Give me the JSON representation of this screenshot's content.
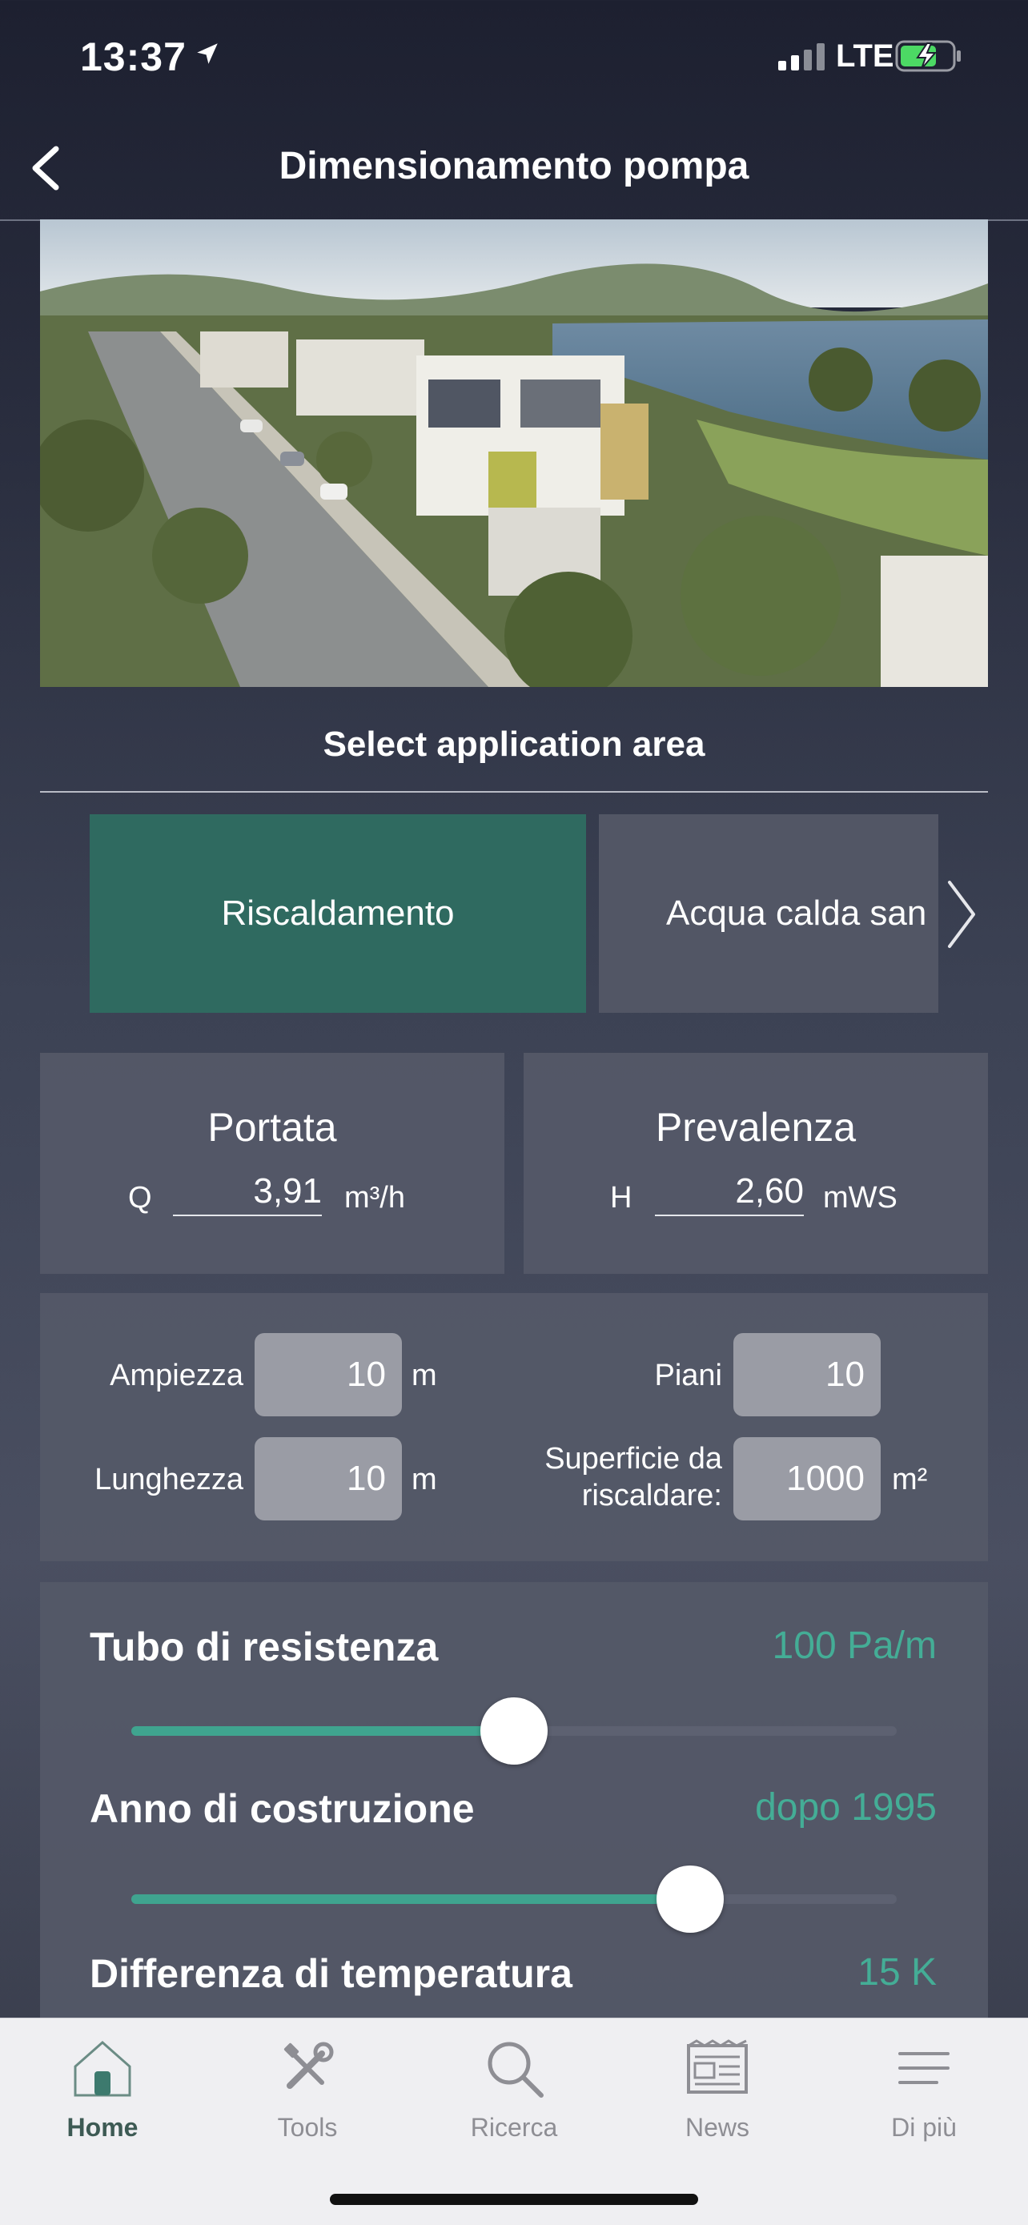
{
  "status_bar": {
    "time": "13:37",
    "network": "LTE"
  },
  "nav": {
    "title": "Dimensionamento pompa"
  },
  "application": {
    "heading": "Select application area",
    "tabs": [
      {
        "label": "Riscaldamento",
        "selected": true
      },
      {
        "label": "Acqua calda san",
        "selected": false
      }
    ]
  },
  "flow": {
    "title": "Portata",
    "symbol": "Q",
    "value": "3,91",
    "unit": "m³/h"
  },
  "head": {
    "title": "Prevalenza",
    "symbol": "H",
    "value": "2,60",
    "unit": "mWS"
  },
  "dimensions": {
    "width": {
      "label": "Ampiezza",
      "value": "10",
      "unit": "m"
    },
    "length": {
      "label": "Lunghezza",
      "value": "10",
      "unit": "m"
    },
    "floors": {
      "label": "Piani",
      "value": "10"
    },
    "surface": {
      "label_line1": "Superficie da",
      "label_line2": "riscaldare:",
      "value": "1000",
      "unit": "m²"
    }
  },
  "sliders": [
    {
      "label": "Tubo di resistenza",
      "value": "100 Pa/m",
      "level": 0.5
    },
    {
      "label": "Anno di costruzione",
      "value": "dopo 1995",
      "level": 0.73
    },
    {
      "label": "Differenza di temperatura",
      "value": "15 K"
    }
  ],
  "tabbar": {
    "items": [
      {
        "label": "Home",
        "icon": "home-icon",
        "active": true
      },
      {
        "label": "Tools",
        "icon": "tools-icon",
        "active": false
      },
      {
        "label": "Ricerca",
        "icon": "search-icon",
        "active": false
      },
      {
        "label": "News",
        "icon": "news-icon",
        "active": false
      },
      {
        "label": "Di più",
        "icon": "menu-icon",
        "active": false
      }
    ]
  },
  "colors": {
    "accent": "#3fa48f",
    "tab_active": "#2f6a60",
    "value_text": "#44ad96"
  }
}
